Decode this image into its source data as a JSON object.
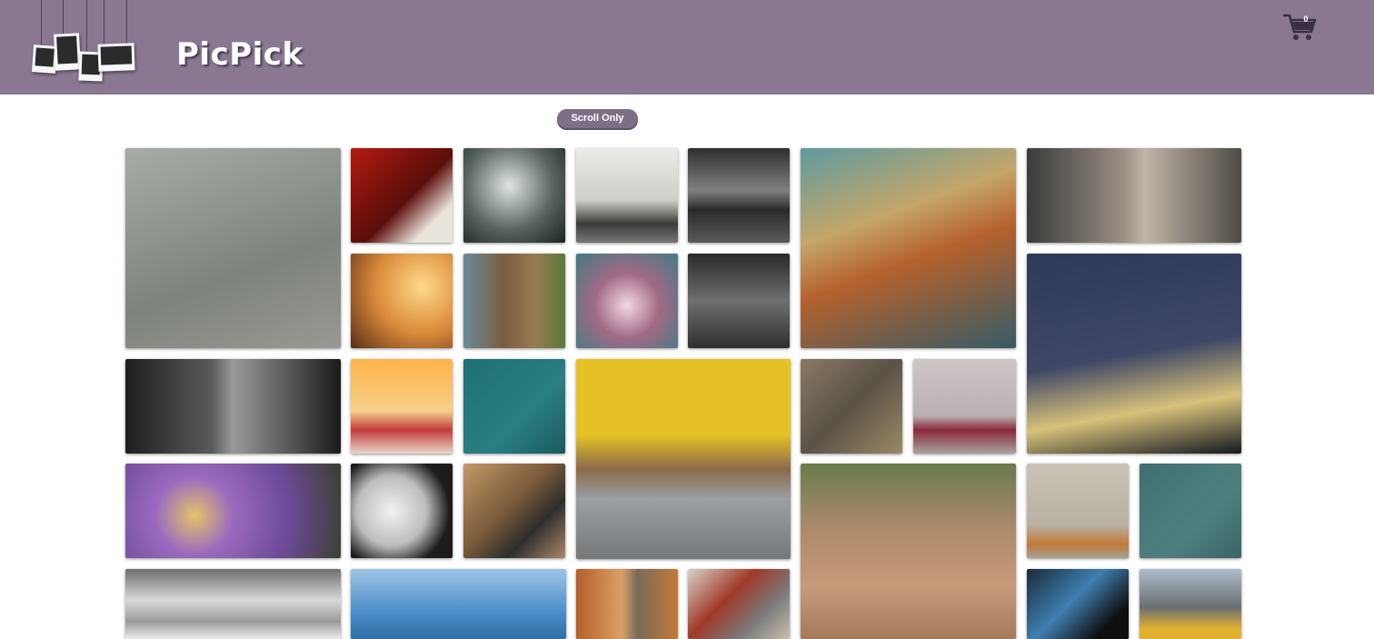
{
  "app": {
    "brand": "PicPick",
    "accent_color": "#8a7893"
  },
  "header": {
    "cart": {
      "icon": "shopping-cart-icon",
      "count": "0"
    }
  },
  "controls": {
    "scroll_only_label": "Scroll Only"
  },
  "gallery": {
    "photos": [
      {
        "name": "photo-man-walking-street"
      },
      {
        "name": "photo-white-heels-red-wall"
      },
      {
        "name": "photo-crossed-forks"
      },
      {
        "name": "photo-bench-white-wall"
      },
      {
        "name": "photo-bridge-city-night-bw"
      },
      {
        "name": "photo-tuk-tuk-license-plate"
      },
      {
        "name": "photo-city-street-buildings"
      },
      {
        "name": "photo-girl-sunset-field"
      },
      {
        "name": "photo-wooden-shed-bicycle"
      },
      {
        "name": "photo-cherry-blossoms"
      },
      {
        "name": "photo-city-traffic-aerial"
      },
      {
        "name": "photo-bridge-night-sky"
      },
      {
        "name": "photo-hands-vintage-camera"
      },
      {
        "name": "photo-strawberries-sunlight"
      },
      {
        "name": "photo-boat-teal-water"
      },
      {
        "name": "photo-vintage-cars-yellow-doors"
      },
      {
        "name": "photo-leaves-wooden-boards"
      },
      {
        "name": "photo-red-tricycle"
      },
      {
        "name": "photo-purple-petunias"
      },
      {
        "name": "photo-clock-face"
      },
      {
        "name": "photo-person-laptop"
      },
      {
        "name": "photo-leopard-dirt-road"
      },
      {
        "name": "photo-hay-bale-field"
      },
      {
        "name": "photo-birds-flying-sky"
      },
      {
        "name": "photo-clouds-bw"
      },
      {
        "name": "photo-misty-blue-trees"
      },
      {
        "name": "photo-narrow-alley"
      },
      {
        "name": "photo-bicycle-handlebars"
      },
      {
        "name": "photo-hand-phone"
      },
      {
        "name": "photo-city-street-taxis"
      }
    ]
  }
}
